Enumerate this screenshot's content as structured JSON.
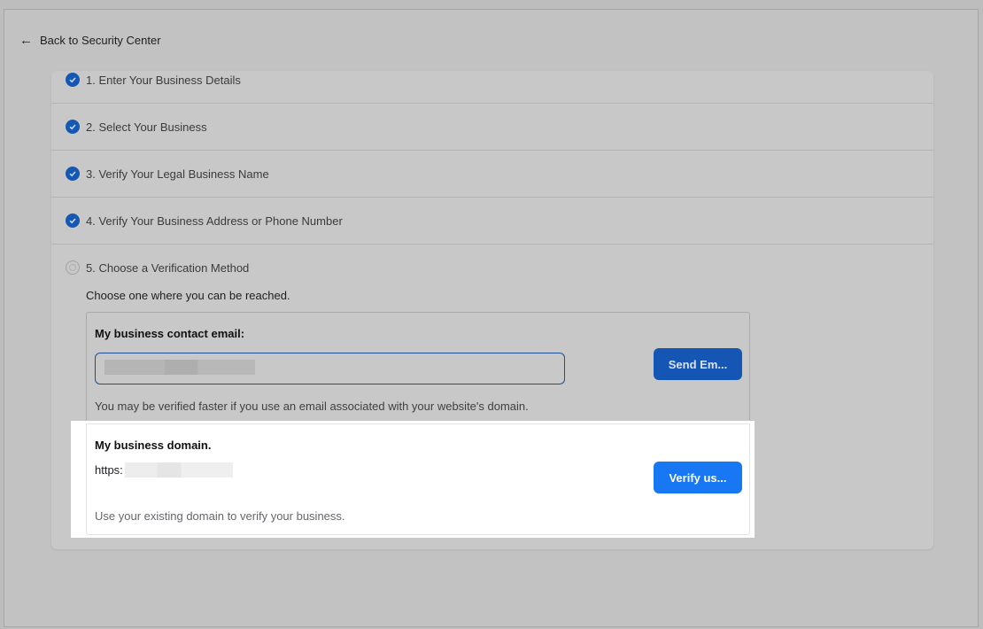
{
  "back_link": {
    "label": "Back to Security Center",
    "icon": "arrow-left-icon"
  },
  "steps": [
    {
      "label": "1. Enter Your Business Details",
      "status": "complete"
    },
    {
      "label": "2. Select Your Business",
      "status": "complete"
    },
    {
      "label": "3. Verify Your Legal Business Name",
      "status": "complete"
    },
    {
      "label": "4. Verify Your Business Address or Phone Number",
      "status": "complete"
    },
    {
      "label": "5. Choose a Verification Method",
      "status": "current"
    }
  ],
  "verification": {
    "instruction": "Choose one where you can be reached.",
    "email": {
      "title": "My business contact email:",
      "value": "",
      "button": "Send Em...",
      "help": "You may be verified faster if you use an email associated with your website's domain."
    },
    "domain": {
      "title": "My business domain.",
      "url_prefix": "https:",
      "button": "Verify us...",
      "help": "Use your existing domain to verify your business."
    }
  },
  "colors": {
    "accent": "#1877f2",
    "check": "#1558b4"
  }
}
